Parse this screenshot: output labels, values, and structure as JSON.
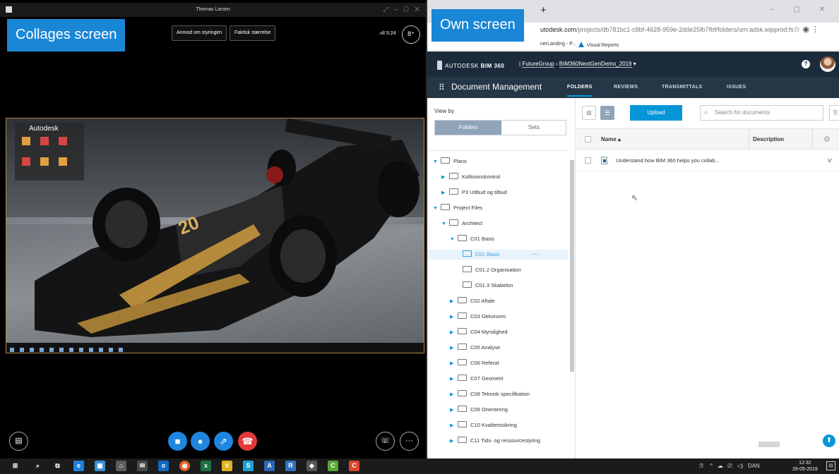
{
  "labels": {
    "left": "Collages screen",
    "right": "Own screen"
  },
  "skype": {
    "title": "Thomas Larsen",
    "request_control": "Anmod om styringen",
    "actual_size": "Faktisk størrelse",
    "signal": ".ııll 5:24",
    "desktop_title": "Autodesk"
  },
  "browser": {
    "url_domain": "utodesk.com",
    "url_path": "/projects/db781bc1-c8bf-4628-959e-2dde25fb7fbf/folders/urn:adsk.wipprod:fs...",
    "bookmark_1": "nerLanding - P...",
    "bookmark_2": "Visual Reports"
  },
  "bim": {
    "brand_prefix": "AUTODESK",
    "brand": "BIM 360",
    "account": "FutureGroup",
    "project": "BIM360NextGenDemo_2019",
    "module": "Document Management",
    "tabs": [
      "FOLDERS",
      "REVIEWS",
      "TRANSMITTALS",
      "ISSUES"
    ]
  },
  "left_panel": {
    "view_by": "View by",
    "folders": "Folders",
    "sets": "Sets"
  },
  "tree": [
    {
      "label": "Plans"
    },
    {
      "label": "Kollisionskontrol"
    },
    {
      "label": "P3 Udbud og tilbud"
    },
    {
      "label": "Project Files"
    },
    {
      "label": "Architect"
    },
    {
      "label": "C01 Basis"
    },
    {
      "label": "C01 Basis"
    },
    {
      "label": "C01.2 Organisation"
    },
    {
      "label": "C01.3 Skabelon"
    },
    {
      "label": "C02 Aftale"
    },
    {
      "label": "C03 Oekonomi"
    },
    {
      "label": "C04 Myndighed"
    },
    {
      "label": "C05 Analyse"
    },
    {
      "label": "C06 Referat"
    },
    {
      "label": "C07 Geometri"
    },
    {
      "label": "C08 Teknisk specifikation"
    },
    {
      "label": "C09 Orientering"
    },
    {
      "label": "C10 Kvalitetssikring"
    },
    {
      "label": "C11 Tids- og ressourcestyring"
    }
  ],
  "main": {
    "upload": "Upload",
    "search_placeholder": "Search for documents",
    "col_name": "Name ▴",
    "col_description": "Description",
    "file_name": "Understand how BIM 360 helps you collab...",
    "file_extra": "V:"
  },
  "taskbar": {
    "lang": "DAN",
    "time": "12:32",
    "date": "29-05-2019"
  }
}
